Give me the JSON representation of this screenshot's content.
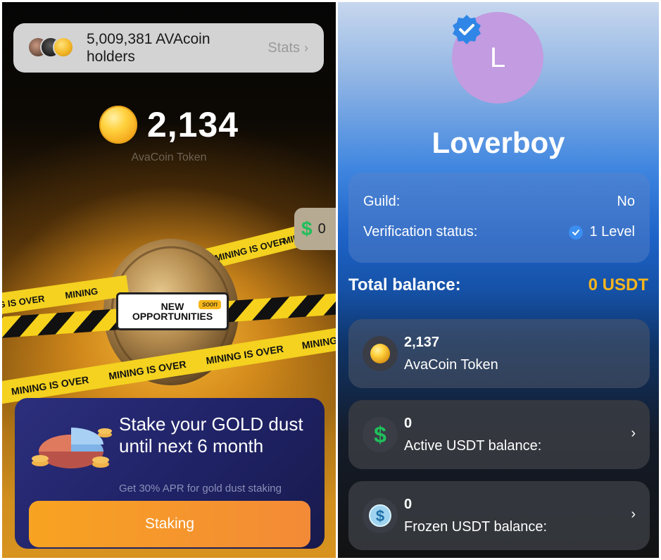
{
  "left": {
    "holders": {
      "text": "5,009,381 AVAcoin holders",
      "stats_label": "Stats",
      "chevron": "›"
    },
    "balance": {
      "value": "2,134",
      "label": "AvaCoin Token",
      "coin_icon": "gold-coin-icon"
    },
    "usdt_chip": {
      "symbol": "$",
      "value": "0"
    },
    "tape": {
      "top_band": [
        "MINING IS OVER",
        "MINING IS OVER"
      ],
      "mid_band": [
        "G IS OVER",
        "MINING"
      ],
      "bottom_band": [
        "MINING IS OVER",
        "MINING IS OVER",
        "MINING IS OVER",
        "MINING"
      ]
    },
    "opportunity": {
      "text_line1": "NEW",
      "text_line2": "OPPORTUNITIES",
      "badge": "soon"
    },
    "stake": {
      "title": "Stake your GOLD dust until next 6 month",
      "subtitle": "Get 30% APR for gold dust staking",
      "button": "Staking"
    }
  },
  "right": {
    "avatar_letter": "L",
    "username": "Loverboy",
    "info": {
      "guild_label": "Guild:",
      "guild_value": "No",
      "verification_label": "Verification status:",
      "verification_value": "1 Level"
    },
    "total": {
      "label": "Total balance:",
      "value": "0 USDT"
    },
    "balances": [
      {
        "amount": "2,137",
        "label": "AvaCoin Token",
        "icon": "gold-coin-icon"
      },
      {
        "amount": "0",
        "label": "Active USDT balance:",
        "icon": "green-dollar-icon"
      },
      {
        "amount": "0",
        "label": "Frozen USDT balance:",
        "icon": "frozen-dollar-icon"
      }
    ],
    "chevron": "›"
  },
  "colors": {
    "accent_gold": "#f6b51d",
    "stake_button": "#f8a321",
    "usdt_green": "#1fbf5b",
    "verified_blue": "#3b8ef0",
    "avatar_purple": "#c29be0"
  }
}
